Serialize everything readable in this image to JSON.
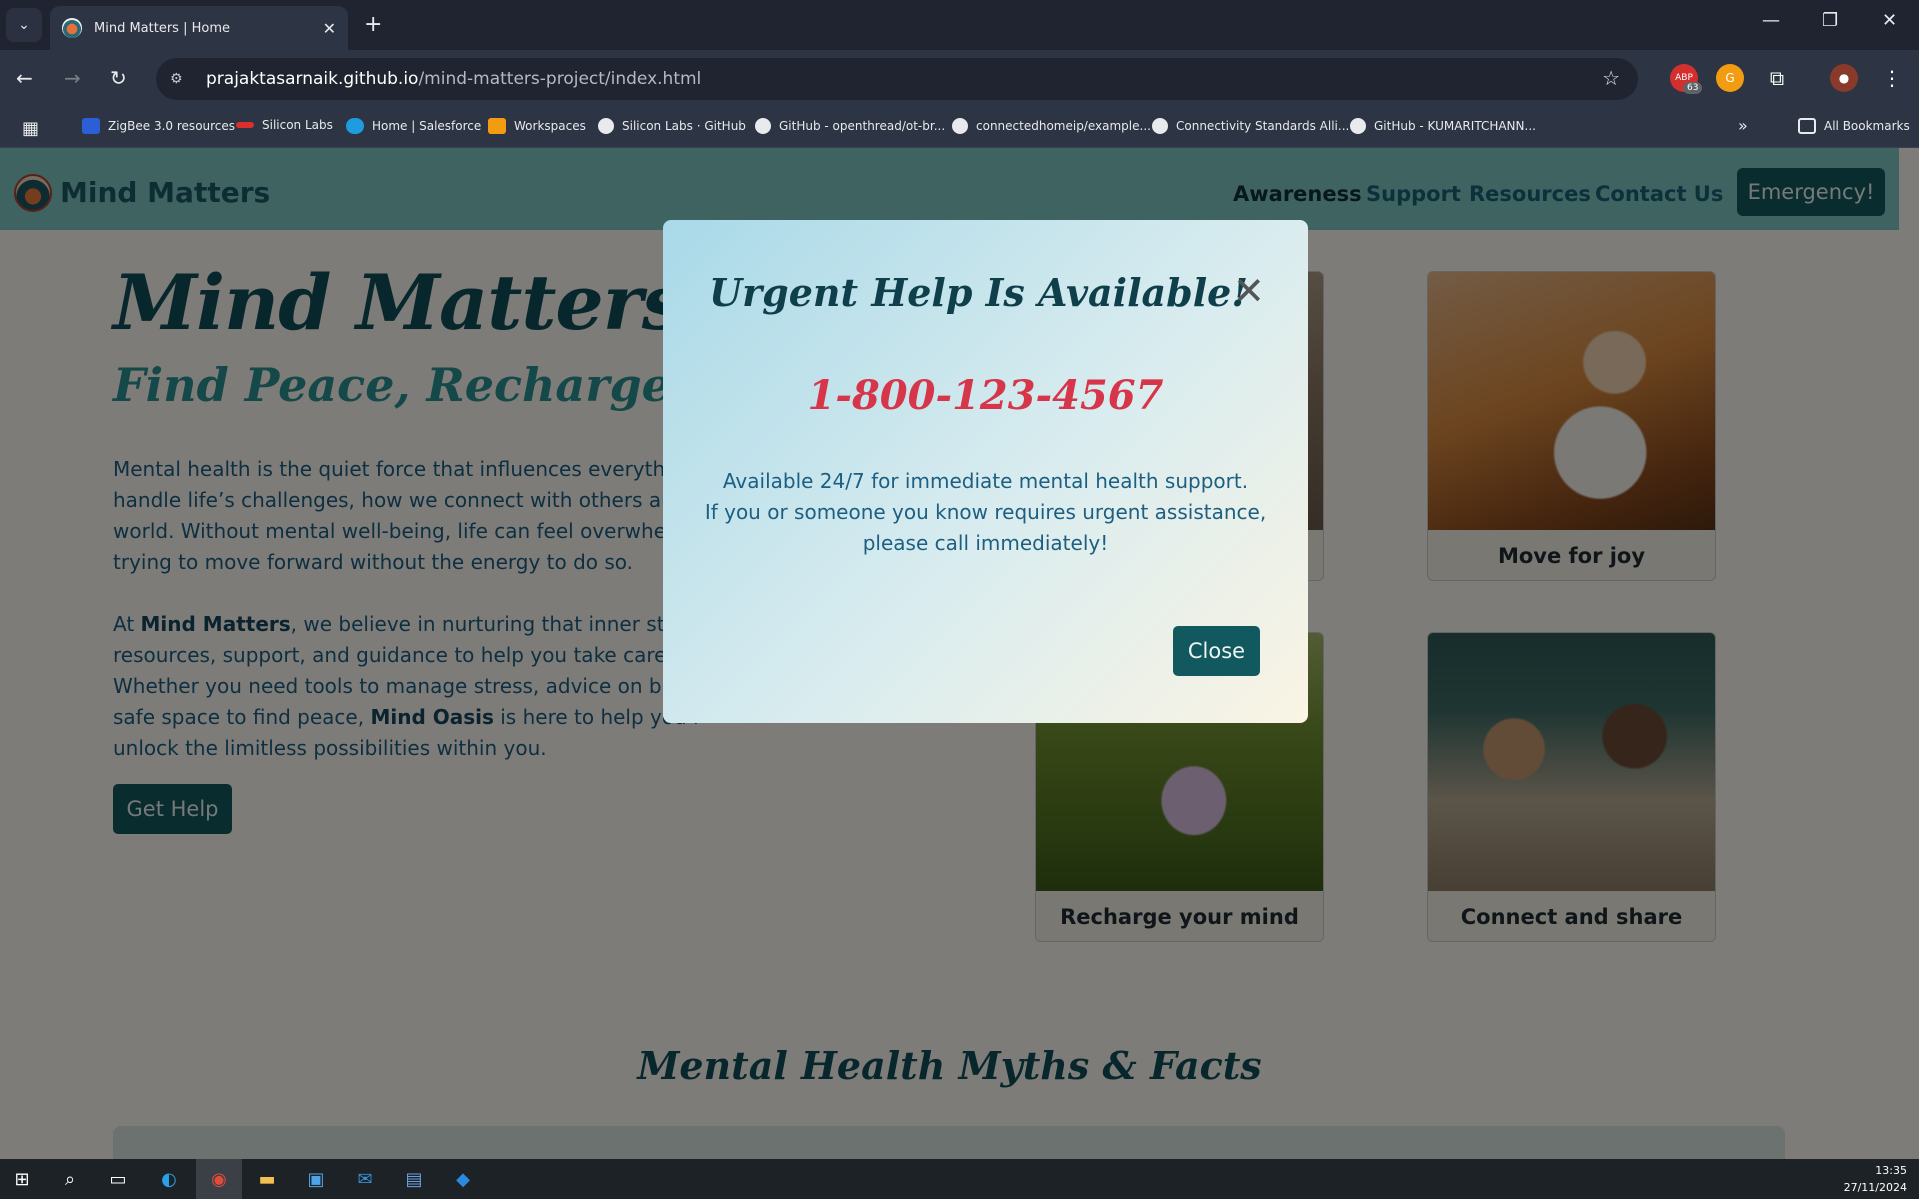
{
  "browser": {
    "tab_title": "Mind Matters | Home",
    "url_host": "prajaktasarnaik.github.io",
    "url_path": "/mind-matters-project/index.html",
    "ext_badge": "63",
    "bookmarks": [
      "ZigBee 3.0 resources",
      "Silicon Labs",
      "Home | Salesforce",
      "Workspaces",
      "Silicon Labs · GitHub",
      "GitHub - openthread/ot-br...",
      "connectedhomeip/example...",
      "Connectivity Standards Alli...",
      "GitHub - KUMARITCHANN..."
    ],
    "all_bookmarks": "All Bookmarks"
  },
  "site": {
    "brand": "Mind Matters",
    "nav": [
      "Awareness",
      "Support",
      "Resources",
      "Contact Us"
    ],
    "emergency": "Emergency!"
  },
  "hero": {
    "title": "Mind Matters",
    "subtitle": "Find Peace, Recharge Your",
    "p1": "Mental health is the quiet force that influences everything",
    "p1_l2": "handle life’s challenges, how we connect with others and",
    "p1_l3": "world. Without mental well-being, life can feel overwhelm",
    "p1_l4": "trying to move forward without the energy to do so.",
    "p2_l1a": "At ",
    "p2_l1b": "Mind Matters",
    "p2_l1c": ", we believe in nurturing that inner stren",
    "p2_l2": "resources, support, and guidance to help you take care of",
    "p2_l3": "Whether you need tools to manage stress, advice on build",
    "p2_l4a": "safe space to find peace, ",
    "p2_l4b": "Mind Oasis",
    "p2_l4c": " is here to help you r",
    "p2_l5": "unlock the limitless possibilities within you.",
    "cta": "Get Help"
  },
  "cards": [
    "Move for joy",
    "Recharge your mind",
    "Connect and share"
  ],
  "myths_title": "Mental Health Myths & Facts",
  "modal": {
    "title": "Urgent Help Is Available!",
    "phone": "1-800-123-4567",
    "line1": "Available 24/7 for immediate mental health support.",
    "line2": "If you or someone you know requires urgent assistance,",
    "line3": "please call immediately!",
    "close": "Close"
  },
  "taskbar": {
    "time": "13:35",
    "date": "27/11/2024"
  }
}
